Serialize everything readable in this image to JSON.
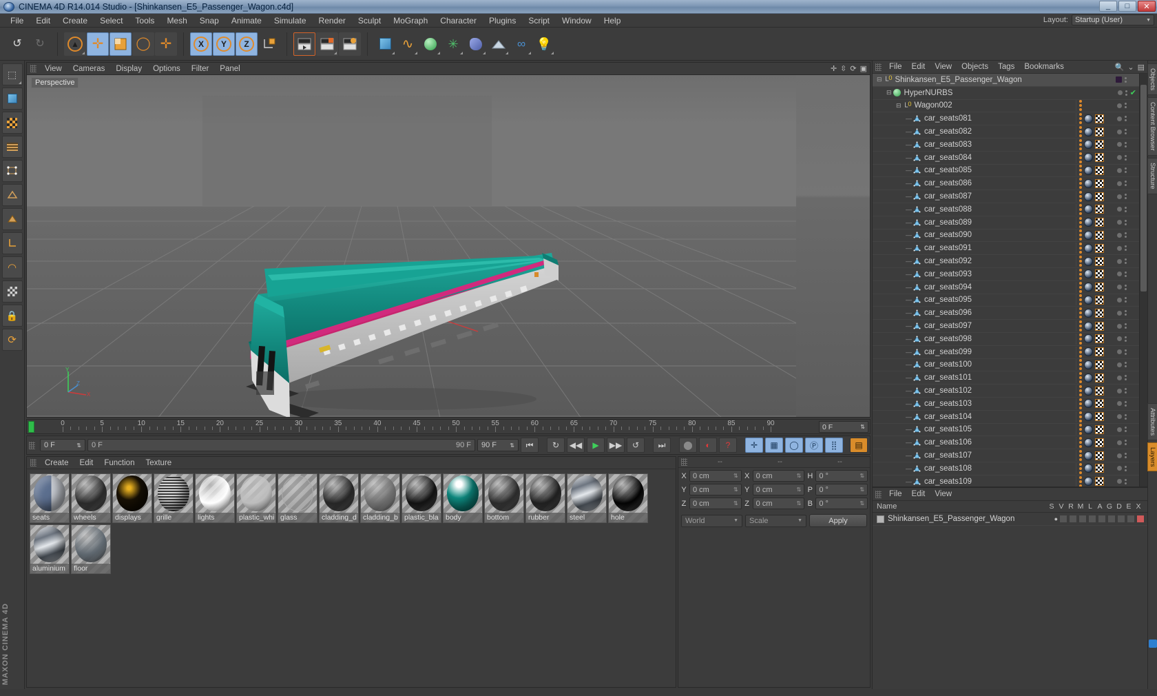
{
  "window": {
    "title": "CINEMA 4D R14.014 Studio - [Shinkansen_E5_Passenger_Wagon.c4d]",
    "minimize": "_",
    "maximize": "□",
    "close": "✕"
  },
  "menubar": {
    "items": [
      "File",
      "Edit",
      "Create",
      "Select",
      "Tools",
      "Mesh",
      "Snap",
      "Animate",
      "Simulate",
      "Render",
      "Sculpt",
      "MoGraph",
      "Character",
      "Plugins",
      "Script",
      "Window",
      "Help"
    ],
    "layout_label": "Layout:",
    "layout_value": "Startup (User)"
  },
  "toolbar": {
    "axis_labels": [
      "X",
      "Y",
      "Z"
    ],
    "icons": [
      "undo-icon",
      "redo-icon",
      "select-icon",
      "move-icon",
      "scale-icon",
      "rotate-icon",
      "add-icon",
      "x-axis-icon",
      "y-axis-icon",
      "z-axis-icon",
      "world-coord-icon",
      "render-view-icon",
      "render-region-icon",
      "render-settings-icon",
      "cube-icon",
      "spline-icon",
      "nurbs-icon",
      "array-icon",
      "deformer-icon",
      "environment-icon",
      "camera-icon",
      "light-icon"
    ]
  },
  "viewport": {
    "menu": [
      "View",
      "Cameras",
      "Display",
      "Options",
      "Filter",
      "Panel"
    ],
    "label": "Perspective",
    "axis": {
      "x": "X",
      "y": "Y",
      "z": "Z"
    }
  },
  "timeline": {
    "ticks": [
      0,
      5,
      10,
      15,
      20,
      25,
      30,
      35,
      40,
      45,
      50,
      55,
      60,
      65,
      70,
      75,
      80,
      85,
      90
    ],
    "current_frame": "0 F"
  },
  "transport": {
    "frame_field": "0 F",
    "start_field": "0 F",
    "end_field": "90 F",
    "preview_end": "90 F",
    "buttons": [
      "go-to-start",
      "prev-key",
      "prev-frame",
      "play",
      "next-frame",
      "next-key",
      "go-to-end",
      "record-icon",
      "autokey-icon",
      "keyframe-help-icon",
      "position-key-icon",
      "scale-key-icon",
      "rotation-key-icon",
      "param-key-icon",
      "point-key-icon",
      "toggle-key-icon"
    ]
  },
  "materials": {
    "menu": [
      "Create",
      "Edit",
      "Function",
      "Texture"
    ],
    "items": [
      {
        "name": "seats",
        "color": "#5c6f8f",
        "type": "two-tone"
      },
      {
        "name": "wheels",
        "color": "#2a2a2a",
        "type": "plain"
      },
      {
        "name": "displays",
        "color": "#1a1205",
        "type": "texture"
      },
      {
        "name": "grille",
        "color": "#8c8c8c",
        "type": "grid"
      },
      {
        "name": "lights",
        "color": "#ffffff",
        "type": "plain"
      },
      {
        "name": "plastic_whi",
        "color": "#bdbdbd",
        "type": "plain"
      },
      {
        "name": "glass",
        "color": "#9a9a9a",
        "type": "transparent"
      },
      {
        "name": "cladding_d",
        "color": "#262626",
        "type": "plain"
      },
      {
        "name": "cladding_b",
        "color": "#6d6d6d",
        "type": "plain"
      },
      {
        "name": "plastic_bla",
        "color": "#121212",
        "type": "plain"
      },
      {
        "name": "body",
        "color": "#0e8a80",
        "type": "logo"
      },
      {
        "name": "bottom",
        "color": "#2b2b2b",
        "type": "plain"
      },
      {
        "name": "rubber",
        "color": "#1f1f1f",
        "type": "plain"
      },
      {
        "name": "steel",
        "color": "#9aa3ab",
        "type": "metal"
      },
      {
        "name": "hole",
        "color": "#030303",
        "type": "plain"
      },
      {
        "name": "aluminium",
        "color": "#8d949c",
        "type": "metal"
      },
      {
        "name": "floor",
        "color": "#5e676f",
        "type": "plain"
      }
    ]
  },
  "coordinates": {
    "headers": [
      "--",
      "--",
      "--"
    ],
    "rows": [
      {
        "l1": "X",
        "v1": "0 cm",
        "l2": "X",
        "v2": "0 cm",
        "l3": "H",
        "v3": "0 °"
      },
      {
        "l1": "Y",
        "v1": "0 cm",
        "l2": "Y",
        "v2": "0 cm",
        "l3": "P",
        "v3": "0 °"
      },
      {
        "l1": "Z",
        "v1": "0 cm",
        "l2": "Z",
        "v2": "0 cm",
        "l3": "B",
        "v3": "0 °"
      }
    ],
    "system": "World",
    "mode": "Scale",
    "apply": "Apply"
  },
  "object_manager": {
    "menu": [
      "File",
      "Edit",
      "View",
      "Objects",
      "Tags",
      "Bookmarks"
    ],
    "rows": [
      {
        "label": "Shinkansen_E5_Passenger_Wagon",
        "depth": 0,
        "icon": "null-object-icon",
        "swatch": "#2e1a3a",
        "tags": false
      },
      {
        "label": "HyperNURBS",
        "depth": 1,
        "icon": "hypernurbs-icon",
        "check": "✔",
        "tags": false
      },
      {
        "label": "Wagon002",
        "depth": 2,
        "icon": "null-object-icon",
        "tags": false,
        "orange": true
      },
      {
        "label": "car_seats081",
        "depth": 3,
        "icon": "polygon-object-icon",
        "tags": true
      },
      {
        "label": "car_seats082",
        "depth": 3,
        "icon": "polygon-object-icon",
        "tags": true
      },
      {
        "label": "car_seats083",
        "depth": 3,
        "icon": "polygon-object-icon",
        "tags": true
      },
      {
        "label": "car_seats084",
        "depth": 3,
        "icon": "polygon-object-icon",
        "tags": true
      },
      {
        "label": "car_seats085",
        "depth": 3,
        "icon": "polygon-object-icon",
        "tags": true
      },
      {
        "label": "car_seats086",
        "depth": 3,
        "icon": "polygon-object-icon",
        "tags": true
      },
      {
        "label": "car_seats087",
        "depth": 3,
        "icon": "polygon-object-icon",
        "tags": true
      },
      {
        "label": "car_seats088",
        "depth": 3,
        "icon": "polygon-object-icon",
        "tags": true
      },
      {
        "label": "car_seats089",
        "depth": 3,
        "icon": "polygon-object-icon",
        "tags": true
      },
      {
        "label": "car_seats090",
        "depth": 3,
        "icon": "polygon-object-icon",
        "tags": true
      },
      {
        "label": "car_seats091",
        "depth": 3,
        "icon": "polygon-object-icon",
        "tags": true
      },
      {
        "label": "car_seats092",
        "depth": 3,
        "icon": "polygon-object-icon",
        "tags": true
      },
      {
        "label": "car_seats093",
        "depth": 3,
        "icon": "polygon-object-icon",
        "tags": true
      },
      {
        "label": "car_seats094",
        "depth": 3,
        "icon": "polygon-object-icon",
        "tags": true
      },
      {
        "label": "car_seats095",
        "depth": 3,
        "icon": "polygon-object-icon",
        "tags": true
      },
      {
        "label": "car_seats096",
        "depth": 3,
        "icon": "polygon-object-icon",
        "tags": true
      },
      {
        "label": "car_seats097",
        "depth": 3,
        "icon": "polygon-object-icon",
        "tags": true
      },
      {
        "label": "car_seats098",
        "depth": 3,
        "icon": "polygon-object-icon",
        "tags": true
      },
      {
        "label": "car_seats099",
        "depth": 3,
        "icon": "polygon-object-icon",
        "tags": true
      },
      {
        "label": "car_seats100",
        "depth": 3,
        "icon": "polygon-object-icon",
        "tags": true
      },
      {
        "label": "car_seats101",
        "depth": 3,
        "icon": "polygon-object-icon",
        "tags": true
      },
      {
        "label": "car_seats102",
        "depth": 3,
        "icon": "polygon-object-icon",
        "tags": true
      },
      {
        "label": "car_seats103",
        "depth": 3,
        "icon": "polygon-object-icon",
        "tags": true
      },
      {
        "label": "car_seats104",
        "depth": 3,
        "icon": "polygon-object-icon",
        "tags": true
      },
      {
        "label": "car_seats105",
        "depth": 3,
        "icon": "polygon-object-icon",
        "tags": true
      },
      {
        "label": "car_seats106",
        "depth": 3,
        "icon": "polygon-object-icon",
        "tags": true
      },
      {
        "label": "car_seats107",
        "depth": 3,
        "icon": "polygon-object-icon",
        "tags": true
      },
      {
        "label": "car_seats108",
        "depth": 3,
        "icon": "polygon-object-icon",
        "tags": true
      },
      {
        "label": "car_seats109",
        "depth": 3,
        "icon": "polygon-object-icon",
        "tags": true
      }
    ]
  },
  "layer_manager": {
    "menu": [
      "File",
      "Edit",
      "View"
    ],
    "name_header": "Name",
    "columns": [
      "S",
      "V",
      "R",
      "M",
      "L",
      "A",
      "G",
      "D",
      "E",
      "X"
    ],
    "rows": [
      {
        "label": "Shinkansen_E5_Passenger_Wagon",
        "color": "#b6b6b6"
      }
    ]
  },
  "right_tabs": [
    "Objects",
    "Content Browser",
    "Structure",
    "Attributes",
    "Layers"
  ],
  "branding": "MAXON CINEMA 4D"
}
